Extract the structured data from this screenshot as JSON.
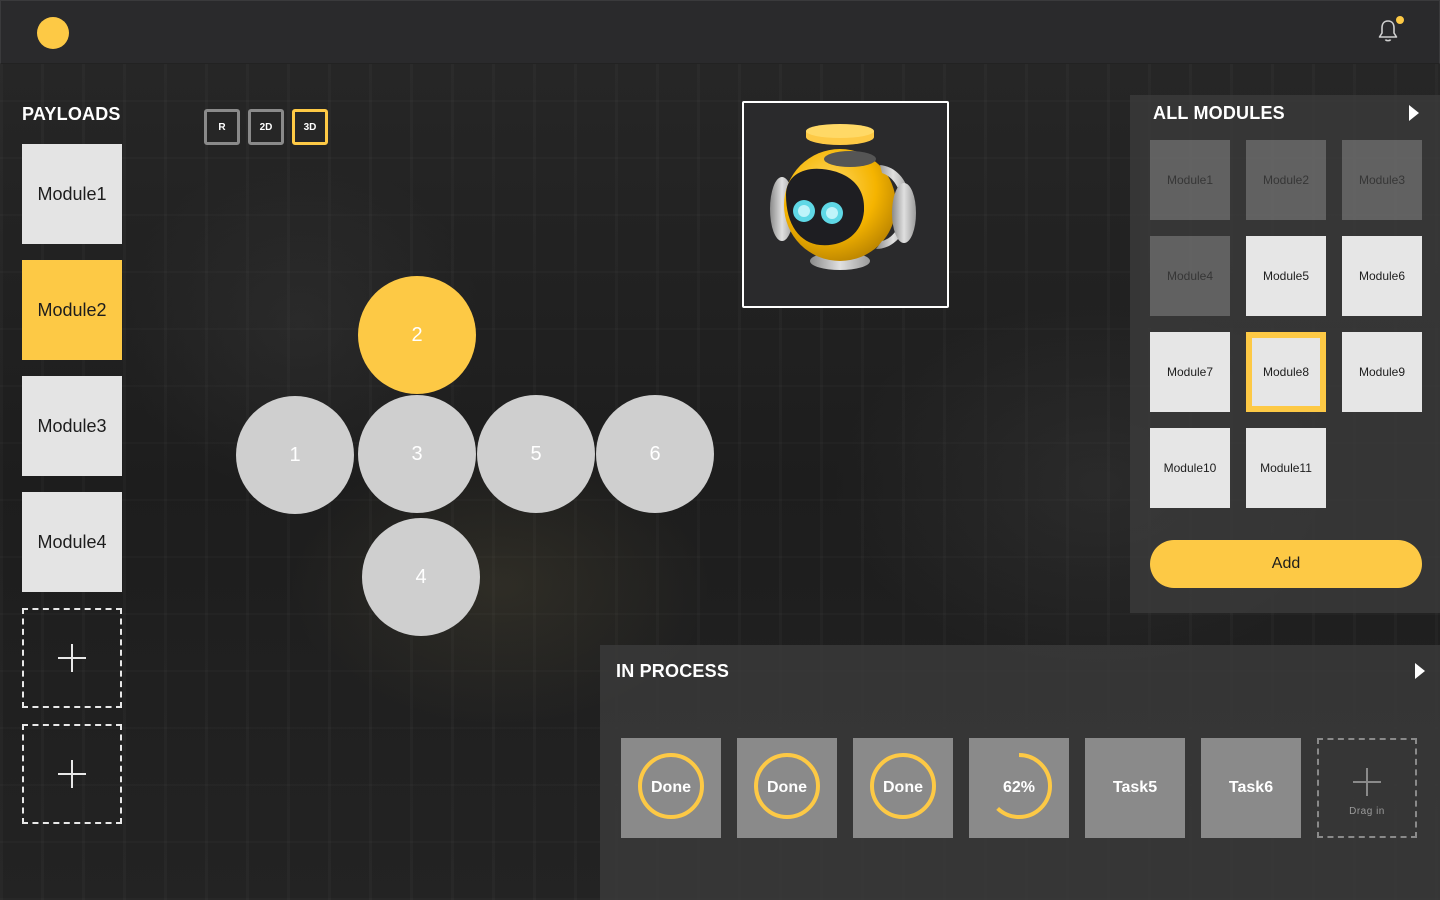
{
  "colors": {
    "accent": "#fdc945",
    "module_bg": "#e4e4e4",
    "bubble": "#cfcfcf",
    "task_bg": "#8a8a8a",
    "panel_bg": "#3a3a3a"
  },
  "header": {
    "logo_icon": "yellow-dot-icon",
    "notifications_icon": "bell-icon",
    "has_unread": true
  },
  "payloads": {
    "title": "PAYLOADS",
    "items": [
      {
        "label": "Module1",
        "active": false
      },
      {
        "label": "Module2",
        "active": true
      },
      {
        "label": "Module3",
        "active": false
      },
      {
        "label": "Module4",
        "active": false
      }
    ],
    "empty_slots": 2
  },
  "view_modes": {
    "options": [
      "R",
      "2D",
      "3D"
    ],
    "selected": "3D"
  },
  "layout_bubbles": [
    {
      "label": "2",
      "active": true
    },
    {
      "label": "1",
      "active": false
    },
    {
      "label": "3",
      "active": false
    },
    {
      "label": "5",
      "active": false
    },
    {
      "label": "6",
      "active": false
    },
    {
      "label": "4",
      "active": false
    }
  ],
  "all_modules": {
    "title": "ALL MODULES",
    "items": [
      {
        "label": "Module1",
        "state": "used"
      },
      {
        "label": "Module2",
        "state": "used"
      },
      {
        "label": "Module3",
        "state": "used"
      },
      {
        "label": "Module4",
        "state": "used"
      },
      {
        "label": "Module5",
        "state": "available"
      },
      {
        "label": "Module6",
        "state": "available"
      },
      {
        "label": "Module7",
        "state": "available"
      },
      {
        "label": "Module8",
        "state": "selected"
      },
      {
        "label": "Module9",
        "state": "available"
      },
      {
        "label": "Module10",
        "state": "available"
      },
      {
        "label": "Module11",
        "state": "available"
      }
    ],
    "add_label": "Add"
  },
  "in_process": {
    "title": "IN PROCESS",
    "tasks": [
      {
        "label": "Done",
        "progress": 1.0
      },
      {
        "label": "Done",
        "progress": 1.0
      },
      {
        "label": "Done",
        "progress": 1.0
      },
      {
        "label": "62%",
        "progress": 0.62
      },
      {
        "label": "Task5",
        "progress": null
      },
      {
        "label": "Task6",
        "progress": null
      }
    ],
    "drop_label": "Drag in"
  }
}
